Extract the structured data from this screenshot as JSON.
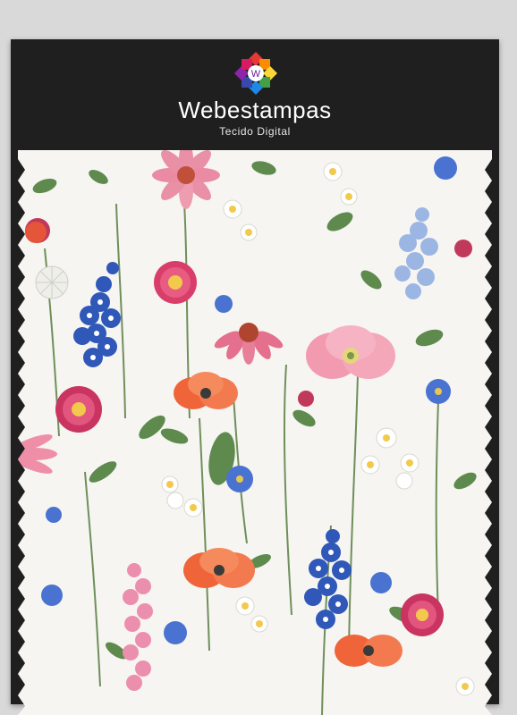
{
  "brand": {
    "name": "Webestampas",
    "tagline": "Tecido Digital",
    "logo_icon": "flower-logo-icon"
  },
  "colors": {
    "card_background": "#1f1f1f",
    "fabric_background": "#f6f5f2",
    "brand_text": "#ffffff"
  }
}
